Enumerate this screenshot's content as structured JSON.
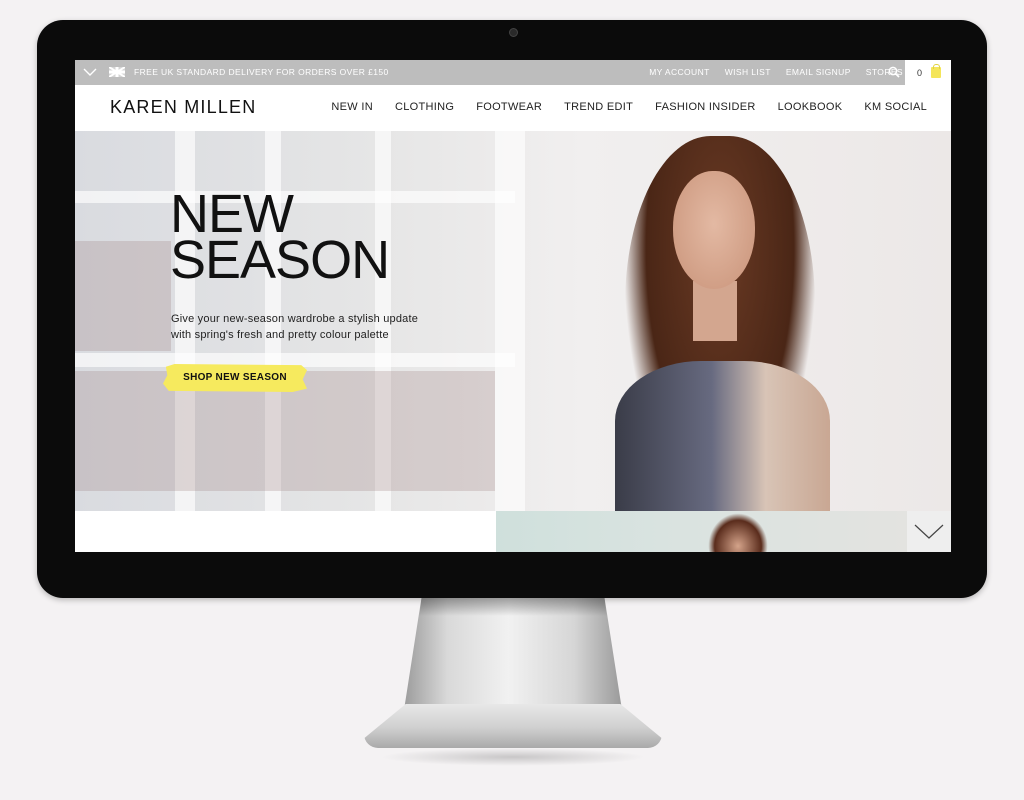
{
  "topbar": {
    "promo": "FREE UK STANDARD DELIVERY FOR ORDERS OVER £150",
    "links": [
      "MY ACCOUNT",
      "WISH LIST",
      "EMAIL SIGNUP",
      "STORES"
    ],
    "cart_count": "0"
  },
  "header": {
    "logo": "KAREN MILLEN",
    "nav": [
      "NEW IN",
      "CLOTHING",
      "FOOTWEAR",
      "TREND EDIT",
      "FASHION INSIDER",
      "LOOKBOOK",
      "KM SOCIAL"
    ]
  },
  "hero": {
    "headline_line1": "NEW",
    "headline_line2": "SEASON",
    "subcopy_line1": "Give your new-season wardrobe a stylish update",
    "subcopy_line2": "with spring's fresh and pretty colour palette",
    "cta": "SHOP NEW SEASON"
  },
  "colors": {
    "topbar_bg": "#bdbdbd",
    "cta_yellow": "#f6ea5e",
    "monitor_bezel": "#0b0b0b"
  },
  "icons": [
    "chevron-down-icon",
    "uk-flag-icon",
    "search-icon",
    "shopping-bag-icon",
    "scroll-down-chevron-icon"
  ]
}
